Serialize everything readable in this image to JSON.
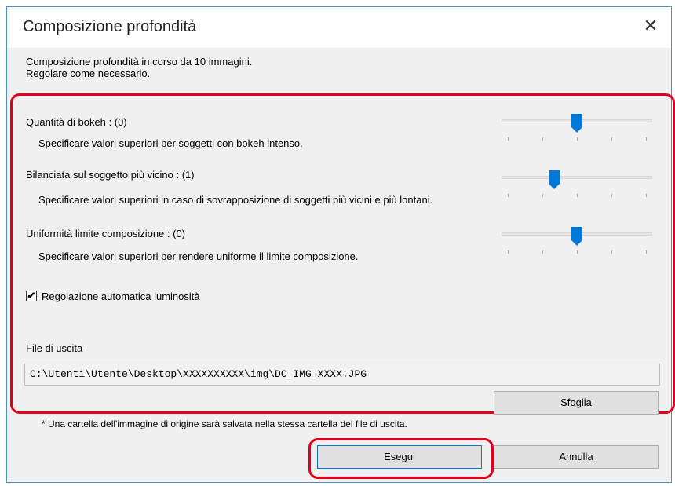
{
  "dialog": {
    "title": "Composizione profondità",
    "close_glyph": "✕"
  },
  "intro": {
    "line1": "Composizione profondità in corso da 10 immagini.",
    "line2": "Regolare come necessario."
  },
  "settings": [
    {
      "label": "Quantità di bokeh : (0)",
      "description": "Specificare valori superiori per soggetti con bokeh intenso.",
      "slider_level": 0.5
    },
    {
      "label": "Bilanciata sul soggetto più vicino : (1)",
      "description": "Specificare valori superiori in caso di sovrapposizione di soggetti più vicini e più lontani.",
      "slider_level": 0.35
    },
    {
      "label": "Uniformità limite composizione : (0)",
      "description": "Specificare valori superiori per rendere uniforme il limite composizione.",
      "slider_level": 0.5
    }
  ],
  "auto_brightness": {
    "label": "Regolazione automatica luminosità",
    "checked": true,
    "check_glyph": "✔"
  },
  "output": {
    "label": "File di uscita",
    "path": "C:\\Utenti\\Utente\\Desktop\\XXXXXXXXXX\\img\\DC_IMG_XXXX.JPG",
    "browse_label": "Sfoglia"
  },
  "note": "* Una cartella dell'immagine di origine sarà salvata nella stessa cartella del file di uscita.",
  "buttons": {
    "run": "Esegui",
    "cancel": "Annulla"
  },
  "colors": {
    "accent": "#0078d7",
    "highlight": "#e0001b"
  }
}
